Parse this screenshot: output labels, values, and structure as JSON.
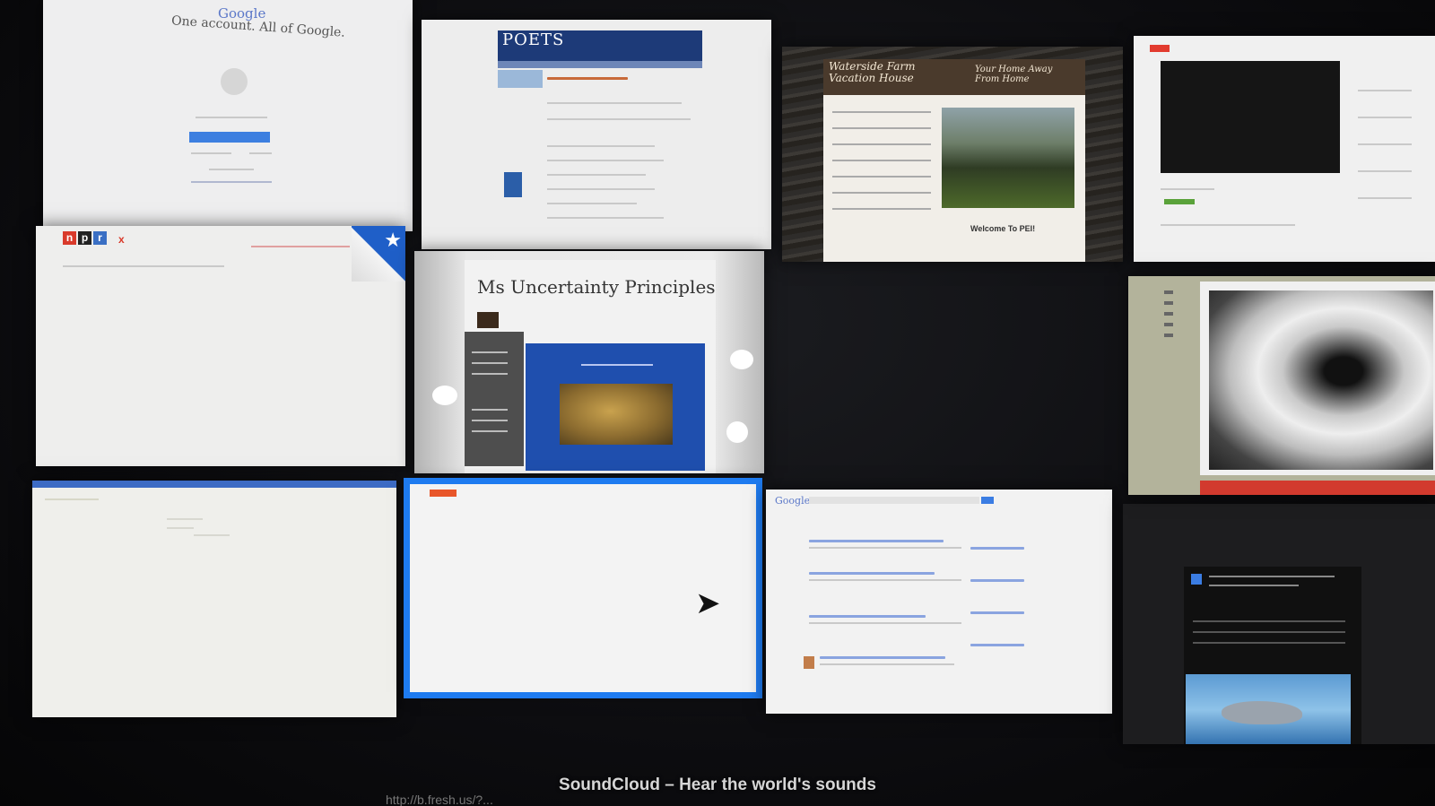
{
  "tiles": {
    "google_account": {
      "logo": "Google",
      "title": "One account. All of Google."
    },
    "poets": {
      "logo": "POETS"
    },
    "waterside": {
      "title": "Waterside Farm Vacation House",
      "tagline": "Your Home Away From Home",
      "welcome": "Welcome To PEI!"
    },
    "npr": {
      "logo_letters": [
        "n",
        "p",
        "r"
      ],
      "brand_color": "#d93a2b",
      "peel_icon": "star-icon"
    },
    "blog": {
      "title": "Ms Uncertainty Principles"
    },
    "google_results": {
      "logo": "Google"
    }
  },
  "status_bar": {
    "title": "SoundCloud – Hear the world's sounds",
    "url": "http://b.fresh.us/?..."
  },
  "colors": {
    "selection": "#1e7bf0",
    "background": "#0b0b0d"
  }
}
